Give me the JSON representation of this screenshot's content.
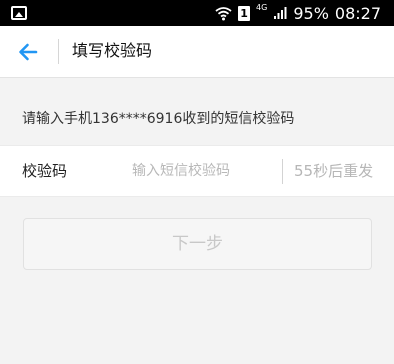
{
  "status_bar": {
    "network_type": "4G",
    "sim_indicator": "1",
    "battery": "95%",
    "time": "08:27",
    "icons": [
      "gallery-icon",
      "wifi-icon",
      "sim-icon",
      "signal-icon"
    ]
  },
  "header": {
    "title": "填写校验码",
    "back_icon": "arrow-left-icon"
  },
  "instruction": "请输入手机136****6916收到的短信校验码",
  "verification": {
    "label": "校验码",
    "input_value": "",
    "input_placeholder": "输入短信校验码",
    "resend_label": "55秒后重发"
  },
  "actions": {
    "next_label": "下一步"
  },
  "colors": {
    "status_bar": "#000000",
    "accent": "#2196f3",
    "background": "#f3f3f3",
    "disabled_text": "#c8c8c8"
  }
}
